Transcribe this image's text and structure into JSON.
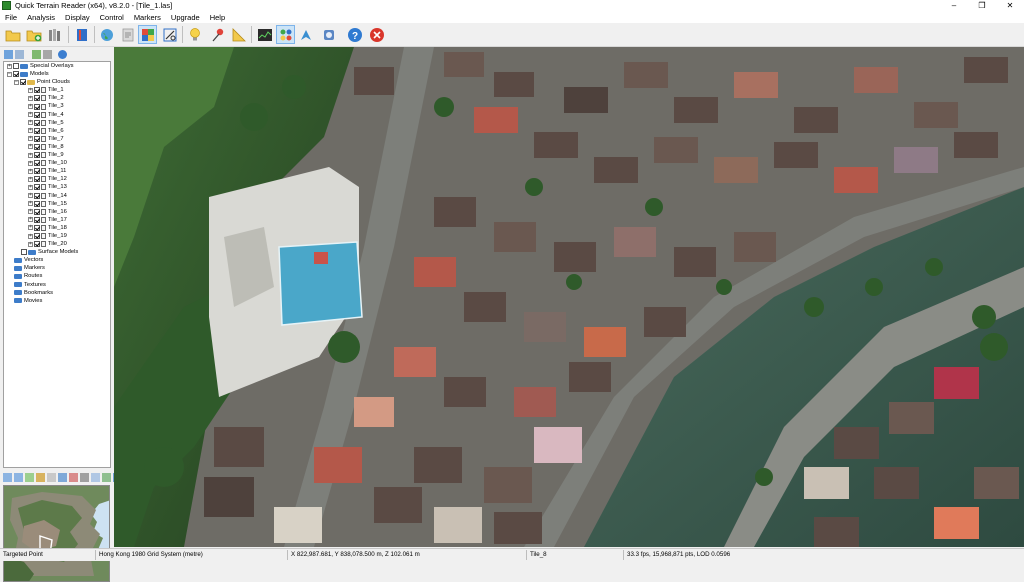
{
  "window": {
    "title": "Quick Terrain Reader (x64), v8.2.0 - [Tile_1.las]",
    "minimize": "–",
    "restore": "❒",
    "close": "✕"
  },
  "menu": [
    "File",
    "Analysis",
    "Display",
    "Control",
    "Markers",
    "Upgrade",
    "Help"
  ],
  "toolbar": {
    "icons": [
      "open-folder-icon",
      "add-folder-icon",
      "layers-stack-icon",
      "book-icon",
      "globe-icon",
      "clipboard-icon",
      "color-palette-icon",
      "measure-icon",
      "lightbulb-icon",
      "marker-pin-icon",
      "ruler-triangle-icon",
      "profile-graph-icon",
      "grid-view-icon",
      "fly-icon",
      "flashlight-icon",
      "help-icon",
      "exit-icon"
    ]
  },
  "tree": {
    "special_overlays": "Special Overlays",
    "models": "Models",
    "point_clouds": "Point Clouds",
    "tiles": [
      "Tile_1",
      "Tile_2",
      "Tile_3",
      "Tile_4",
      "Tile_5",
      "Tile_6",
      "Tile_7",
      "Tile_8",
      "Tile_9",
      "Tile_10",
      "Tile_11",
      "Tile_12",
      "Tile_13",
      "Tile_14",
      "Tile_15",
      "Tile_16",
      "Tile_17",
      "Tile_18",
      "Tile_19",
      "Tile_20"
    ],
    "surface_models": "Surface Models",
    "vectors": "Vectors",
    "markers": "Markers",
    "routes": "Routes",
    "textures": "Textures",
    "bookmarks": "Bookmarks",
    "movies": "Movies"
  },
  "status": {
    "mode": "Targeted Point",
    "crs": "Hong Kong 1980 Grid System (metre)",
    "coords": "X 822,987.681, Y 838,078.500 m, Z 102.061 m",
    "tile": "Tile_8",
    "perf": "33.3 fps, 15,968,871 pts, LOD 0.0596"
  },
  "colors": {
    "accent": "#3d7cc9",
    "water": "#3f5a4e",
    "road": "#7d7f7a",
    "vegetation": "#2f5a2a",
    "roof_dark": "#5a4a44",
    "roof_red": "#b4584a",
    "court": "#4aa7c9"
  }
}
